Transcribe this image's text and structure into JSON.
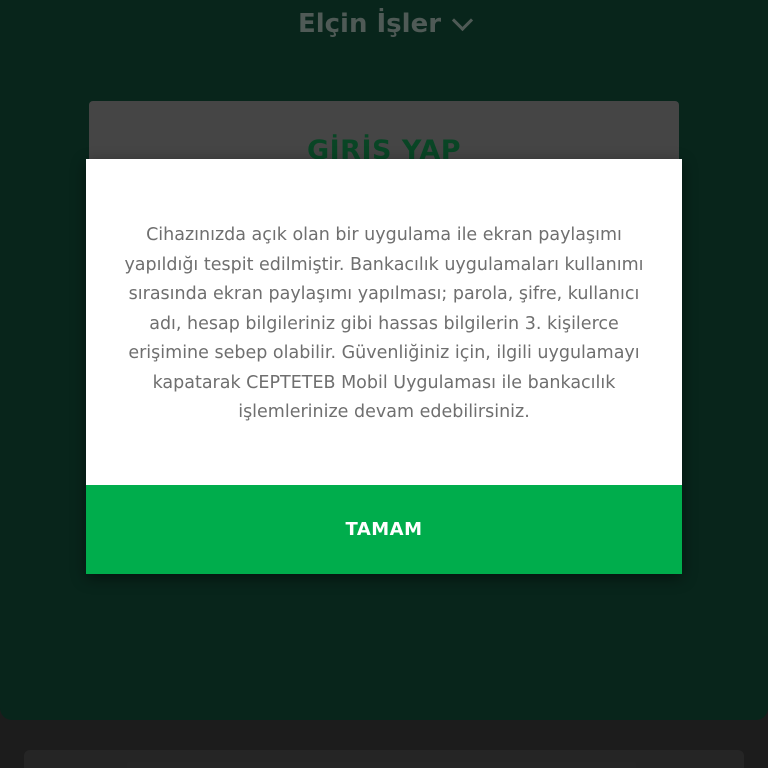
{
  "header": {
    "account_name": "Elçin İşler",
    "chevron_icon": "chevron-down-icon"
  },
  "login": {
    "button_label": "GİRİŞ YAP"
  },
  "dialog": {
    "message": "Cihazınızda açık olan bir uygulama ile ekran paylaşımı yapıldığı tespit edilmiştir. Bankacılık uygulamaları kullanımı sırasında ekran paylaşımı yapılması; parola, şifre, kullanıcı adı, hesap bilgileriniz gibi hassas bilgilerin 3. kişilerce erişimine sebep olabilir. Güvenliğiniz için, ilgili uygulamayı kapatarak CEPTETEB Mobil Uygulaması ile bankacılık işlemlerinize devam edebilirsiniz.",
    "ok_label": "TAMAM"
  },
  "colors": {
    "background_green": "#0d3a2a",
    "accent_green": "#00ad4c",
    "login_text_green": "#0e6b3a"
  }
}
